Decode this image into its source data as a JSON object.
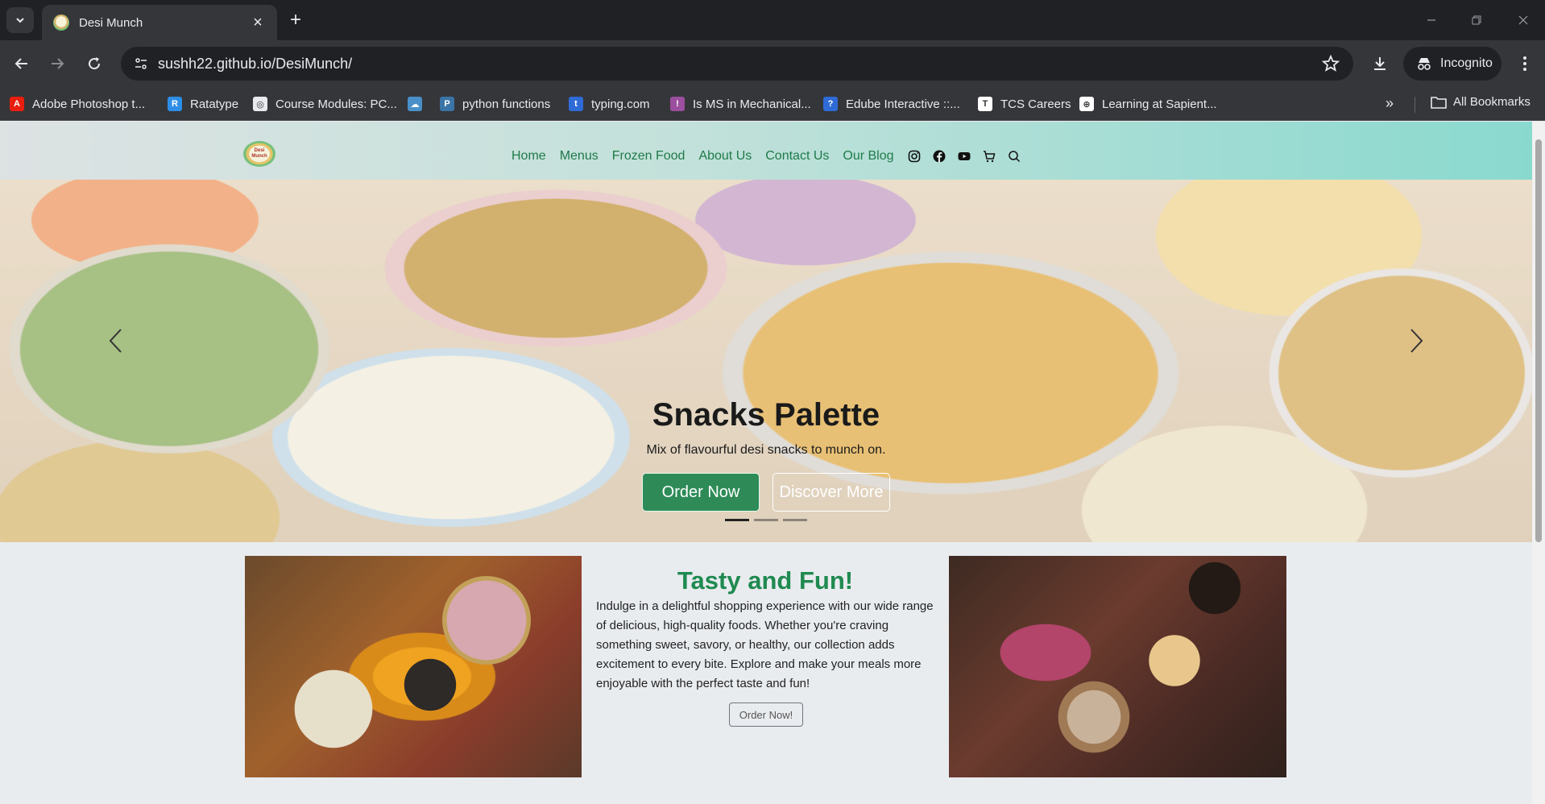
{
  "browser": {
    "tab_title": "Desi Munch",
    "url": "sushh22.github.io/DesiMunch/",
    "incognito_label": "Incognito",
    "bookmarks": [
      {
        "label": "Adobe Photoshop t...",
        "icon": "adobe-icon",
        "color": "#e81e0e"
      },
      {
        "label": "Ratatype",
        "icon": "ratatype-icon",
        "color": "#2d8ee8"
      },
      {
        "label": "Course Modules: PC...",
        "icon": "globe-icon",
        "color": "#e8eaed"
      },
      {
        "label": "",
        "icon": "cloud-icon",
        "color": "#4a90c8"
      },
      {
        "label": "python functions",
        "icon": "python-icon",
        "color": "#3b75a8"
      },
      {
        "label": "typing.com",
        "icon": "typing-icon",
        "color": "#2f6bd6"
      },
      {
        "label": "Is MS in Mechanical...",
        "icon": "pin-icon",
        "color": "#9b4f9e"
      },
      {
        "label": "Edube Interactive ::...",
        "icon": "edube-icon",
        "color": "#2f6bd6"
      },
      {
        "label": "TCS Careers",
        "icon": "tcs-icon",
        "color": "#ffffff"
      },
      {
        "label": "Learning at Sapient...",
        "icon": "sapient-icon",
        "color": "#ffffff"
      }
    ],
    "all_bookmarks_label": "All Bookmarks"
  },
  "site": {
    "logo_text": "Desi Munch",
    "nav": [
      "Home",
      "Menus",
      "Frozen Food",
      "About Us",
      "Contact Us",
      "Our Blog"
    ],
    "nav_icons": [
      "instagram-icon",
      "facebook-icon",
      "youtube-icon",
      "cart-icon",
      "search-icon"
    ],
    "hero": {
      "title": "Snacks Palette",
      "subtitle": "Mix of flavourful desi snacks to munch on.",
      "primary_button": "Order Now",
      "secondary_button": "Discover More",
      "slide_count": 3,
      "active_slide": 1
    },
    "feature": {
      "title": "Tasty and Fun!",
      "text": "Indulge in a delightful shopping experience with our wide range of delicious, high-quality foods. Whether you're craving something sweet, savory, or healthy, our collection adds excitement to every bite. Explore and make your meals more enjoyable with the perfect taste and fun!",
      "button": "Order Now!"
    },
    "colors": {
      "brand_green": "#2e8b57",
      "nav_text": "#1f7a4a"
    }
  }
}
